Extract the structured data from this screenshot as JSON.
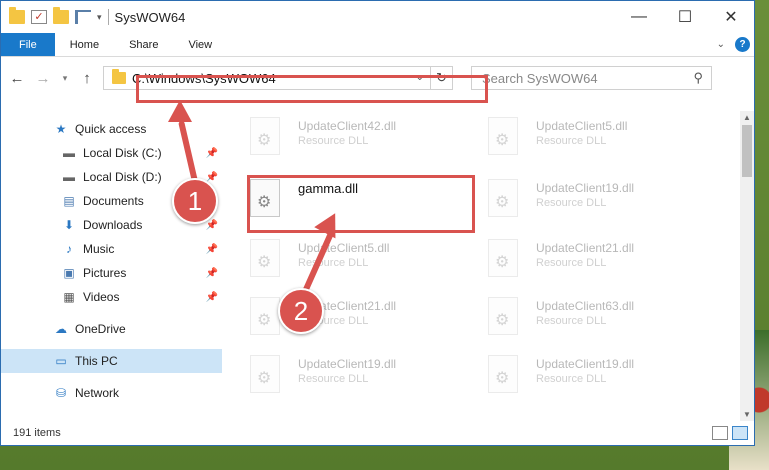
{
  "titlebar": {
    "title": "SysWOW64",
    "minimize": "—",
    "maximize": "☐",
    "close": "✕"
  },
  "ribbon": {
    "tabs": [
      "File",
      "Home",
      "Share",
      "View"
    ],
    "help": "?"
  },
  "address": {
    "path": "C:\\Windows\\SysWOW64",
    "search_placeholder": "Search SysWOW64"
  },
  "sidebar": {
    "items": [
      {
        "label": "Quick access",
        "icon": "star-icon"
      },
      {
        "label": "Local Disk (C:)",
        "icon": "drive-icon"
      },
      {
        "label": "Local Disk (D:)",
        "icon": "drive-icon"
      },
      {
        "label": "Documents",
        "icon": "documents-icon"
      },
      {
        "label": "Downloads",
        "icon": "download-icon"
      },
      {
        "label": "Music",
        "icon": "music-icon"
      },
      {
        "label": "Pictures",
        "icon": "pictures-icon"
      },
      {
        "label": "Videos",
        "icon": "videos-icon"
      },
      {
        "label": "OneDrive",
        "icon": "cloud-icon"
      },
      {
        "label": "This PC",
        "icon": "pc-icon"
      },
      {
        "label": "Network",
        "icon": "network-icon"
      }
    ]
  },
  "files": {
    "left_column": [
      {
        "name": "UpdateClient42.dll",
        "type": "Resource DLL"
      },
      {
        "name": "gamma.dll",
        "type": ""
      },
      {
        "name": "UpdateClient5.dll",
        "type": "Resource DLL"
      },
      {
        "name": "UpdateClient21.dll",
        "type": "Resource DLL"
      },
      {
        "name": "UpdateClient19.dll",
        "type": "Resource DLL"
      }
    ],
    "right_column": [
      {
        "name": "UpdateClient5.dll",
        "type": "Resource DLL"
      },
      {
        "name": "UpdateClient19.dll",
        "type": "Resource DLL"
      },
      {
        "name": "UpdateClient21.dll",
        "type": "Resource DLL"
      },
      {
        "name": "UpdateClient63.dll",
        "type": "Resource DLL"
      },
      {
        "name": "UpdateClient19.dll",
        "type": "Resource DLL"
      }
    ]
  },
  "status": {
    "item_count": "191 items"
  },
  "annotations": {
    "step1": "1",
    "step2": "2",
    "color": "#d9534f"
  }
}
